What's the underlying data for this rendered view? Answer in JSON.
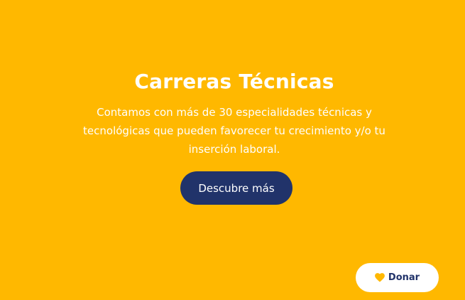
{
  "colors": {
    "background": "#FFB800",
    "primary_button": "#21336A",
    "text_light": "#FFFFFF",
    "donate_text": "#21336A",
    "heart": "#FFB800"
  },
  "hero": {
    "title": "Carreras Técnicas",
    "description": "Contamos con más de 30 especialidades técnicas y tecnológicas que pueden favorecer tu crecimiento y/o tu inserción laboral.",
    "cta_label": "Descubre más"
  },
  "donate": {
    "label": "Donar",
    "icon": "heart-icon"
  }
}
